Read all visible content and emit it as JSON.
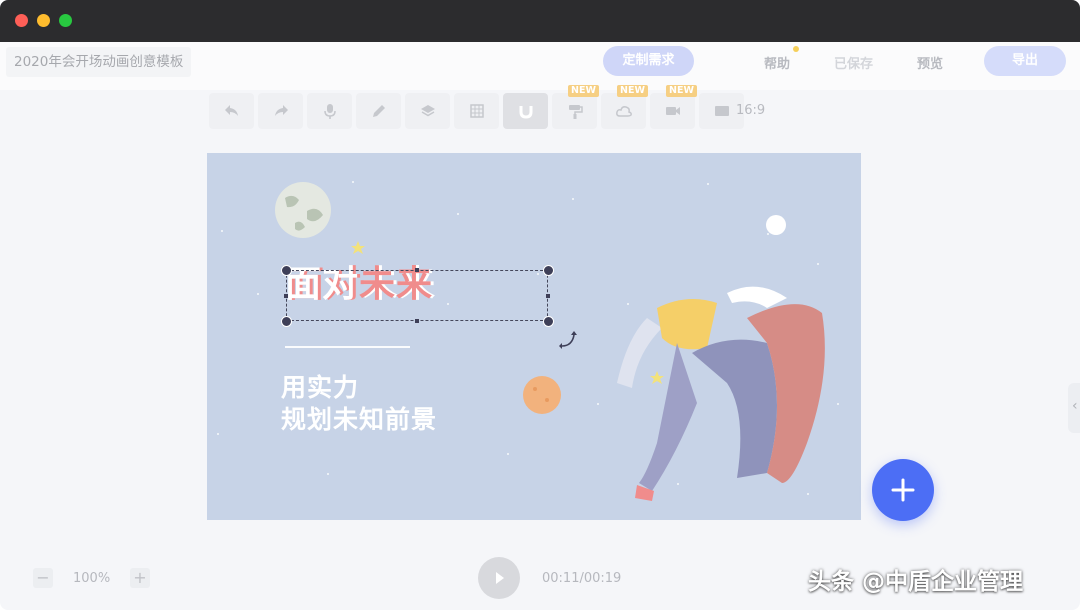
{
  "window": {
    "buttons": [
      "close",
      "minimize",
      "zoom"
    ]
  },
  "header": {
    "doc_title": "2020年会开场动画创意模板",
    "custom_button": "定制需求",
    "help": "帮助",
    "saved": "已保存",
    "preview": "预览",
    "export": "导出"
  },
  "toolbar": {
    "tools": [
      "undo-icon",
      "redo-icon",
      "microphone-icon",
      "pencil-icon",
      "layers-icon",
      "grid-icon",
      "magnet-icon",
      "paint-roller-icon",
      "cloud-icon",
      "camera-icon",
      "screen-icon"
    ],
    "new_badge": "NEW",
    "ratio": "16:9"
  },
  "slide": {
    "title_part1": "面对",
    "title_part2": "未来",
    "subtitle_line1": "用实力",
    "subtitle_line2": "规划未知前景"
  },
  "bottom": {
    "zoom_out": "−",
    "zoom": "100%",
    "zoom_in": "+",
    "time": "00:11/00:19"
  },
  "watermark": "头条 @中盾企业管理",
  "colors": {
    "accent": "#4c6ef5",
    "canvas_bg": "#c7d3e7",
    "title_red": "#f08c8c",
    "new_badge": "#f6cf83"
  }
}
